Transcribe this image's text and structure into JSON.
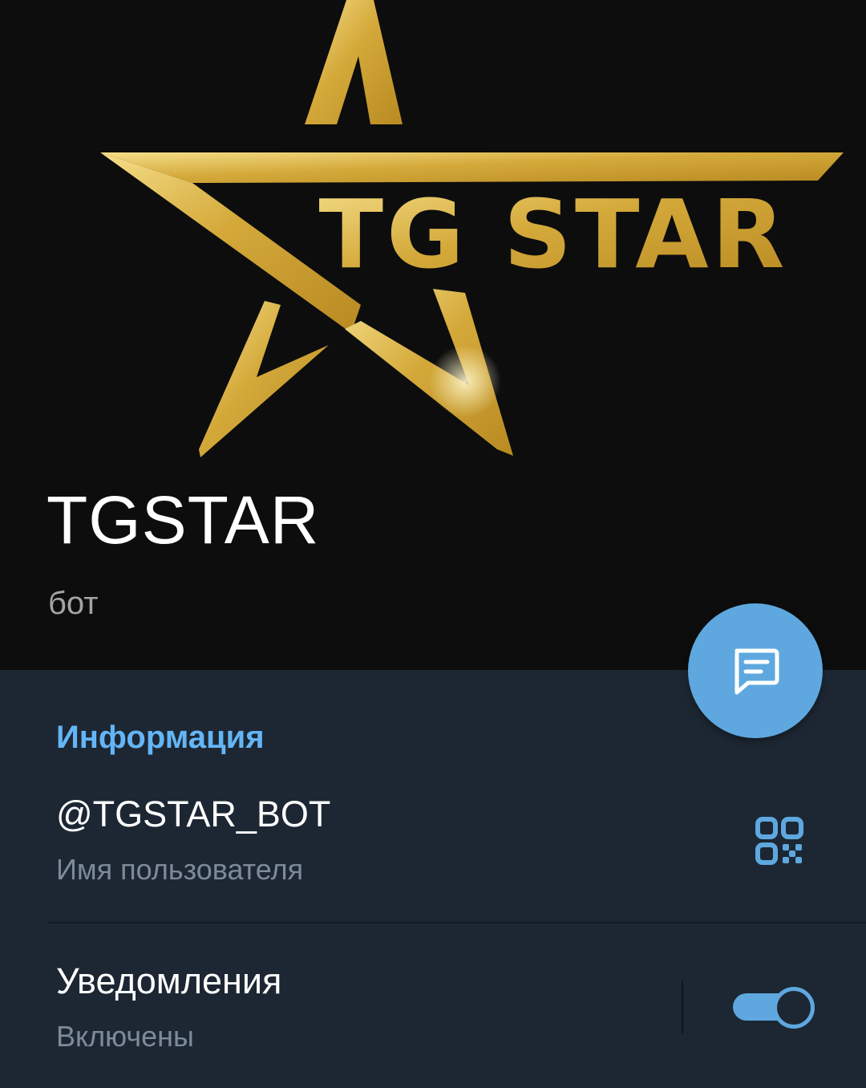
{
  "header": {
    "logo_text": "TG STAR",
    "name": "TGSTAR",
    "status": "бот"
  },
  "fab": {
    "icon": "message-icon"
  },
  "info": {
    "title": "Информация",
    "username": {
      "value": "@TGSTAR_BOT",
      "label": "Имя пользователя",
      "icon": "qr-code-icon"
    },
    "notifications": {
      "value": "Уведомления",
      "label": "Включены",
      "enabled": true
    }
  },
  "colors": {
    "accent": "#5ea8df",
    "section_title": "#64b5f6",
    "background": "#1d2733",
    "header_background": "#0d0d0d",
    "gold": "#d9b44a"
  }
}
